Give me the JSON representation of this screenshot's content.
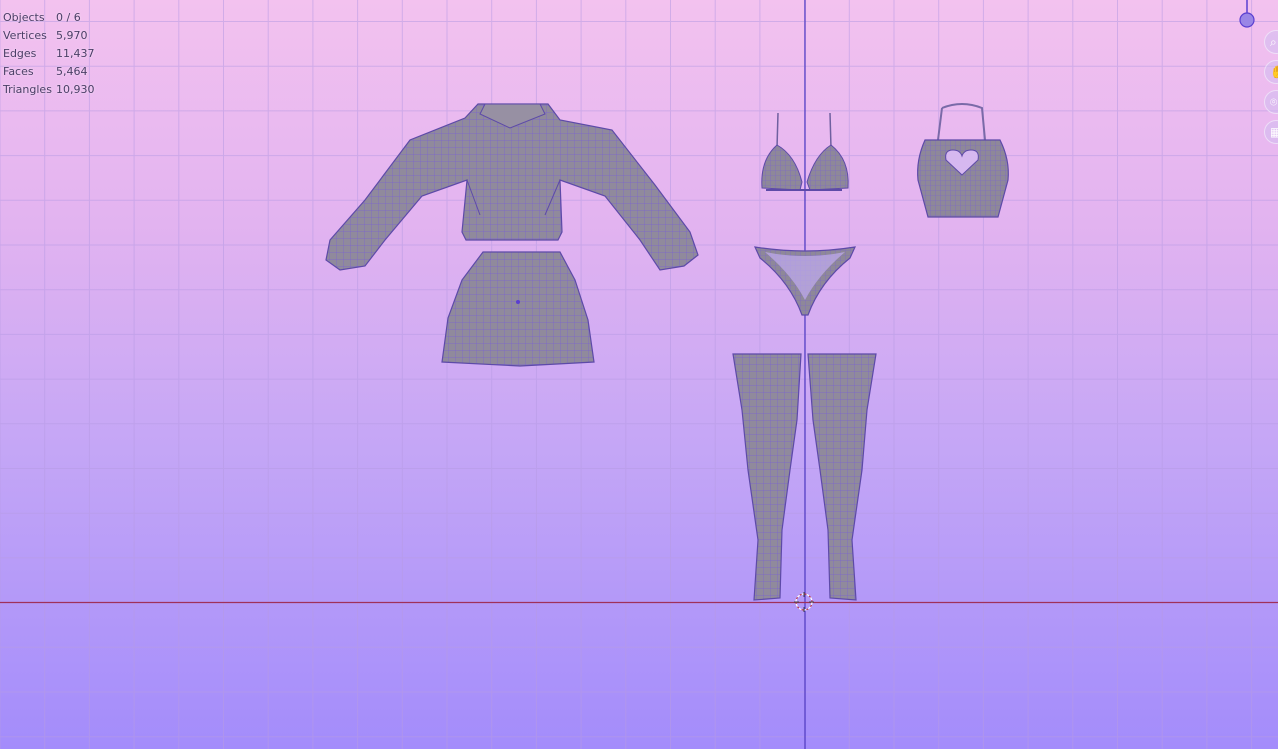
{
  "stats": {
    "rows": [
      {
        "label": "Objects",
        "value": "0 / 6"
      },
      {
        "label": "Vertices",
        "value": "5,970"
      },
      {
        "label": "Edges",
        "value": "11,437"
      },
      {
        "label": "Faces",
        "value": "5,464"
      },
      {
        "label": "Triangles",
        "value": "10,930"
      }
    ]
  },
  "gizmo": {
    "axis_color": "#5a3fd0",
    "buttons": [
      {
        "icon": "zoom-icon"
      },
      {
        "icon": "hand-pan-icon"
      },
      {
        "icon": "camera-icon"
      },
      {
        "icon": "grid-ortho-icon"
      }
    ]
  },
  "colors": {
    "bg_top": "#f3c2ef",
    "bg_bottom": "#a38cfb",
    "mesh_fill": "#8f8a99",
    "wire": "#7a5fd6",
    "x_axis": "#a0305a",
    "z_axis": "#4d38c2"
  }
}
